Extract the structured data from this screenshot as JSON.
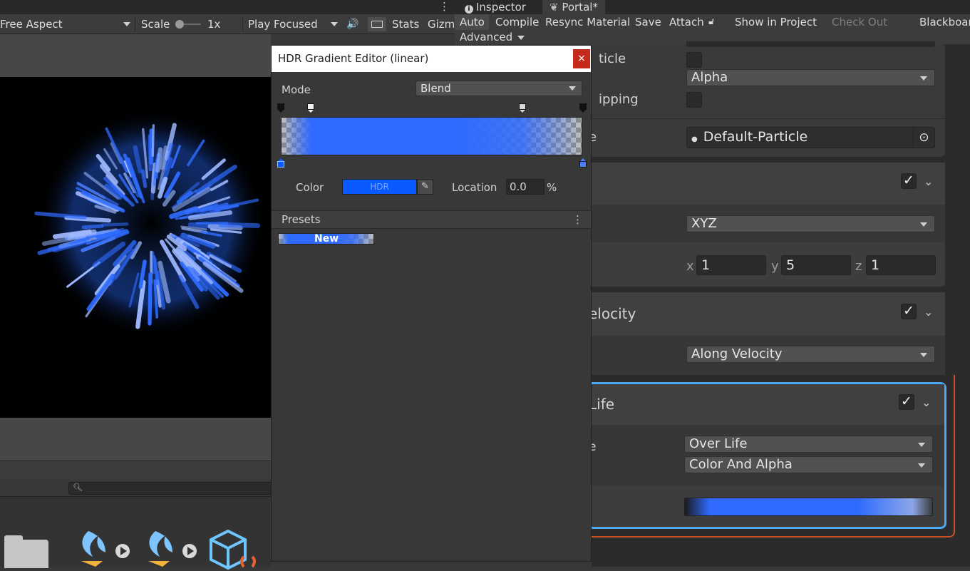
{
  "game_toolbar": {
    "aspect": "Free Aspect",
    "scale_label": "Scale",
    "scale_value": "1x",
    "play_mode": "Play Focused",
    "stats": "Stats",
    "gizmos": "Gizm"
  },
  "right_tabs": {
    "inspector": "Inspector",
    "portal": "Portal*"
  },
  "shadergraph_toolbar": {
    "auto": "Auto",
    "compile": "Compile",
    "resync": "Resync Material",
    "save": "Save",
    "attach": "Attach",
    "show_in_project": "Show in Project",
    "check_out": "Check Out",
    "blackboard": "Blackboar",
    "advanced": "Advanced"
  },
  "inspector": {
    "label_particle": "ticle",
    "label_clipping": "ipping",
    "label_texture": "e",
    "alpha_dropdown": "Alpha",
    "texture_value": "Default-Particle",
    "block1": {
      "dropdown": "XYZ",
      "x_label": "x",
      "x_value": "1",
      "y_label": "y",
      "y_value": "5",
      "z_label": "z",
      "z_value": "1"
    },
    "block2": {
      "title": "elocity",
      "dropdown": "Along Velocity"
    },
    "block3": {
      "title": "Life",
      "row_label": "e",
      "dropdown1": "Over Life",
      "dropdown2": "Color And Alpha"
    }
  },
  "dialog": {
    "title": "HDR Gradient Editor (linear)",
    "close": "×",
    "mode_label": "Mode",
    "mode_value": "Blend",
    "color_label": "Color",
    "color_hdr": "HDR",
    "location_label": "Location",
    "location_value": "0.0",
    "location_unit": "%",
    "presets_label": "Presets",
    "preset_new": "New",
    "colors": {
      "gradient_blue": "#2f6bff",
      "swatch_blue": "#0a5bff"
    }
  }
}
